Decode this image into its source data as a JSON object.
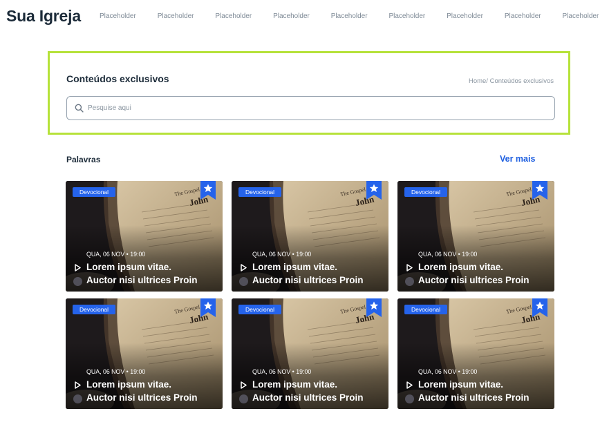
{
  "header": {
    "brand": "Sua Igreja",
    "nav": [
      "Placeholder",
      "Placeholder",
      "Placeholder",
      "Placeholder",
      "Placeholder",
      "Placeholder",
      "Placeholder",
      "Placeholder",
      "Placeholder"
    ]
  },
  "hero": {
    "title": "Conteúdos exclusivos",
    "breadcrumb": {
      "home": "Home/",
      "current": " Conteúdos exclusivos"
    },
    "search_placeholder": "Pesquise aqui",
    "search_value": "",
    "border_color": "#b6e23a"
  },
  "section": {
    "title": "Palavras",
    "see_more": "Ver mais"
  },
  "cards": [
    {
      "tag": "Devocional",
      "date": "QUA, 06 NOV • 19:00",
      "title_line1": "Lorem ipsum vitae.",
      "title_line2": "Auctor nisi ultrices Proin"
    },
    {
      "tag": "Devocional",
      "date": "QUA, 06 NOV • 19:00",
      "title_line1": "Lorem ipsum vitae.",
      "title_line2": "Auctor nisi ultrices Proin"
    },
    {
      "tag": "Devocional",
      "date": "QUA, 06 NOV • 19:00",
      "title_line1": "Lorem ipsum vitae.",
      "title_line2": "Auctor nisi ultrices Proin"
    },
    {
      "tag": "Devocional",
      "date": "QUA, 06 NOV • 19:00",
      "title_line1": "Lorem ipsum vitae.",
      "title_line2": "Auctor nisi ultrices Proin"
    },
    {
      "tag": "Devocional",
      "date": "QUA, 06 NOV • 19:00",
      "title_line1": "Lorem ipsum vitae.",
      "title_line2": "Auctor nisi ultrices Proin"
    },
    {
      "tag": "Devocional",
      "date": "QUA, 06 NOV • 19:00",
      "title_line1": "Lorem ipsum vitae.",
      "title_line2": "Auctor nisi ultrices Proin"
    }
  ],
  "icons": {
    "search": "search-icon",
    "bookmark": "bookmark-star-icon",
    "play": "play-icon"
  },
  "colors": {
    "accent": "#2563eb",
    "link": "#1e5fe0",
    "text": "#1c2b39"
  }
}
